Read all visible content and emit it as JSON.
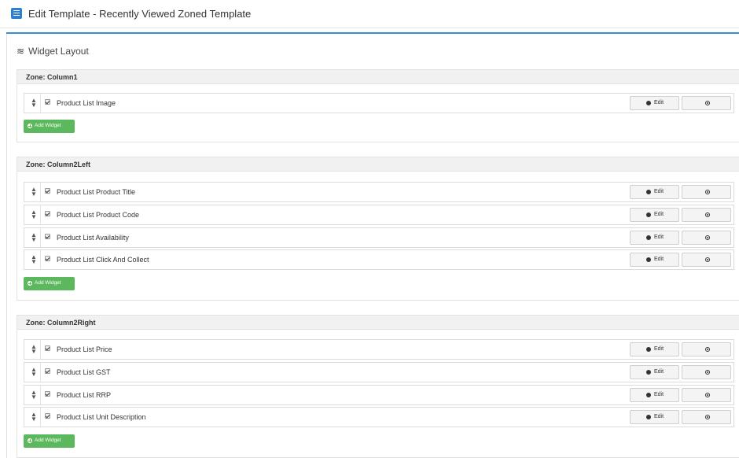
{
  "header": {
    "title": "Edit Template - Recently Viewed Zoned Template",
    "icon": "document-icon"
  },
  "widget_layout": {
    "title": "Widget Layout",
    "icon": "waves-icon"
  },
  "colors": {
    "accent": "#3a8bd6",
    "add_button": "#5cb85c",
    "zone_header_bg": "#f1f1f1"
  },
  "edit_label": "Edit",
  "add_widget_label": "Add Widget",
  "zones": [
    {
      "title": "Zone: Column1",
      "widgets": [
        {
          "label": "Product List Image",
          "checked": true
        }
      ]
    },
    {
      "title": "Zone: Column2Left",
      "widgets": [
        {
          "label": "Product List Product Title",
          "checked": true
        },
        {
          "label": "Product List Product Code",
          "checked": true
        },
        {
          "label": "Product List Availability",
          "checked": true
        },
        {
          "label": "Product List Click And Collect",
          "checked": true
        }
      ]
    },
    {
      "title": "Zone: Column2Right",
      "widgets": [
        {
          "label": "Product List Price",
          "checked": true
        },
        {
          "label": "Product List GST",
          "checked": true
        },
        {
          "label": "Product List RRP",
          "checked": true
        },
        {
          "label": "Product List Unit Description",
          "checked": true
        }
      ]
    }
  ]
}
